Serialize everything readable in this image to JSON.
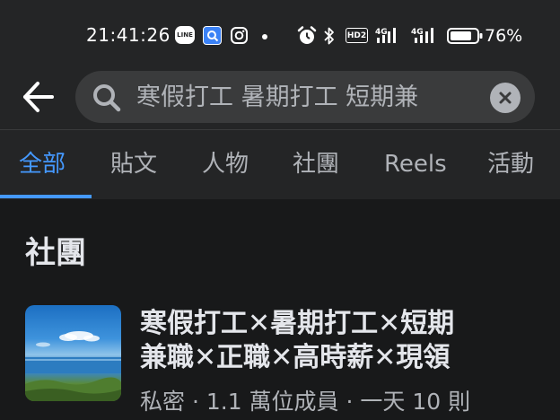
{
  "status_bar": {
    "time": "21:41:26",
    "line_icon_text": "LINE",
    "hd_text": "HD2",
    "network_1": "4G",
    "network_2": "4G",
    "battery_percent": "76%"
  },
  "search": {
    "query": "寒假打工 暑期打工 短期兼"
  },
  "tabs": [
    {
      "label": "全部",
      "active": true
    },
    {
      "label": "貼文",
      "active": false
    },
    {
      "label": "人物",
      "active": false
    },
    {
      "label": "社團",
      "active": false
    },
    {
      "label": "Reels",
      "active": false
    },
    {
      "label": "活動",
      "active": false
    }
  ],
  "section": {
    "title": "社團"
  },
  "group": {
    "name_line_1": "寒假打工✕暑期打工✕短期",
    "name_line_2": "兼職✕正職✕高時薪✕現領",
    "meta": "私密 · 1.1 萬位成員 · 一天 10 則"
  },
  "colors": {
    "accent": "#4599ff",
    "background": "#18191a",
    "bar": "#242526",
    "search_field": "#3a3b3c"
  }
}
